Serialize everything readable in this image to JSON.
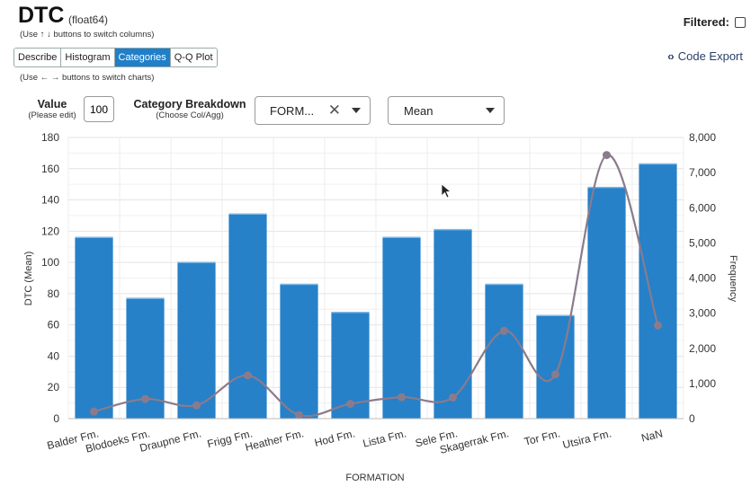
{
  "header": {
    "title": "DTC",
    "dtype": "(float64)",
    "column_hint": "(Use ↑ ↓ buttons to switch columns)",
    "filtered_label": "Filtered:"
  },
  "tabs": [
    {
      "label": "Describe",
      "active": false
    },
    {
      "label": "Histogram",
      "active": false
    },
    {
      "label": "Categories",
      "active": true
    },
    {
      "label": "Q-Q Plot",
      "active": false
    }
  ],
  "chart_hint": "(Use ← → buttons to switch charts)",
  "code_export": {
    "icon": "code-brackets-icon",
    "label": "Code Export"
  },
  "controls": {
    "value_label": "Value",
    "value_sub": "(Please edit)",
    "value": "100",
    "breakdown_label": "Category Breakdown",
    "breakdown_sub": "(Choose Col/Agg)",
    "category_selected": "FORM...",
    "agg_selected": "Mean"
  },
  "chart_data": {
    "type": "bar",
    "categories": [
      "Balder Fm.",
      "Blodoeks Fm.",
      "Draupne Fm.",
      "Frigg Fm.",
      "Heather Fm.",
      "Hod Fm.",
      "Lista Fm.",
      "Sele Fm.",
      "Skagerrak Fm.",
      "Tor Fm.",
      "Utsira Fm.",
      "NaN"
    ],
    "series": [
      {
        "name": "DTC (Mean)",
        "type": "bar",
        "axis": "left",
        "values": [
          116,
          77,
          100,
          131,
          86,
          68,
          116,
          121,
          86,
          66,
          148,
          163
        ],
        "color": "#2681c8"
      },
      {
        "name": "Frequency",
        "type": "line",
        "axis": "right",
        "values": [
          200,
          560,
          380,
          1230,
          100,
          420,
          610,
          600,
          2500,
          1260,
          7500,
          2650
        ],
        "color": "#8a7b8c"
      }
    ],
    "xlabel": "FORMATION",
    "ylabel": "DTC (Mean)",
    "y2label": "Frequency",
    "ylim": [
      0,
      180
    ],
    "y2lim": [
      0,
      8000
    ],
    "yticks": [
      0,
      20,
      40,
      60,
      80,
      100,
      120,
      140,
      160,
      180
    ],
    "y2ticks": [
      "0",
      "1,000",
      "2,000",
      "3,000",
      "4,000",
      "5,000",
      "6,000",
      "7,000",
      "8,000"
    ],
    "grid": true,
    "legend": "none"
  }
}
